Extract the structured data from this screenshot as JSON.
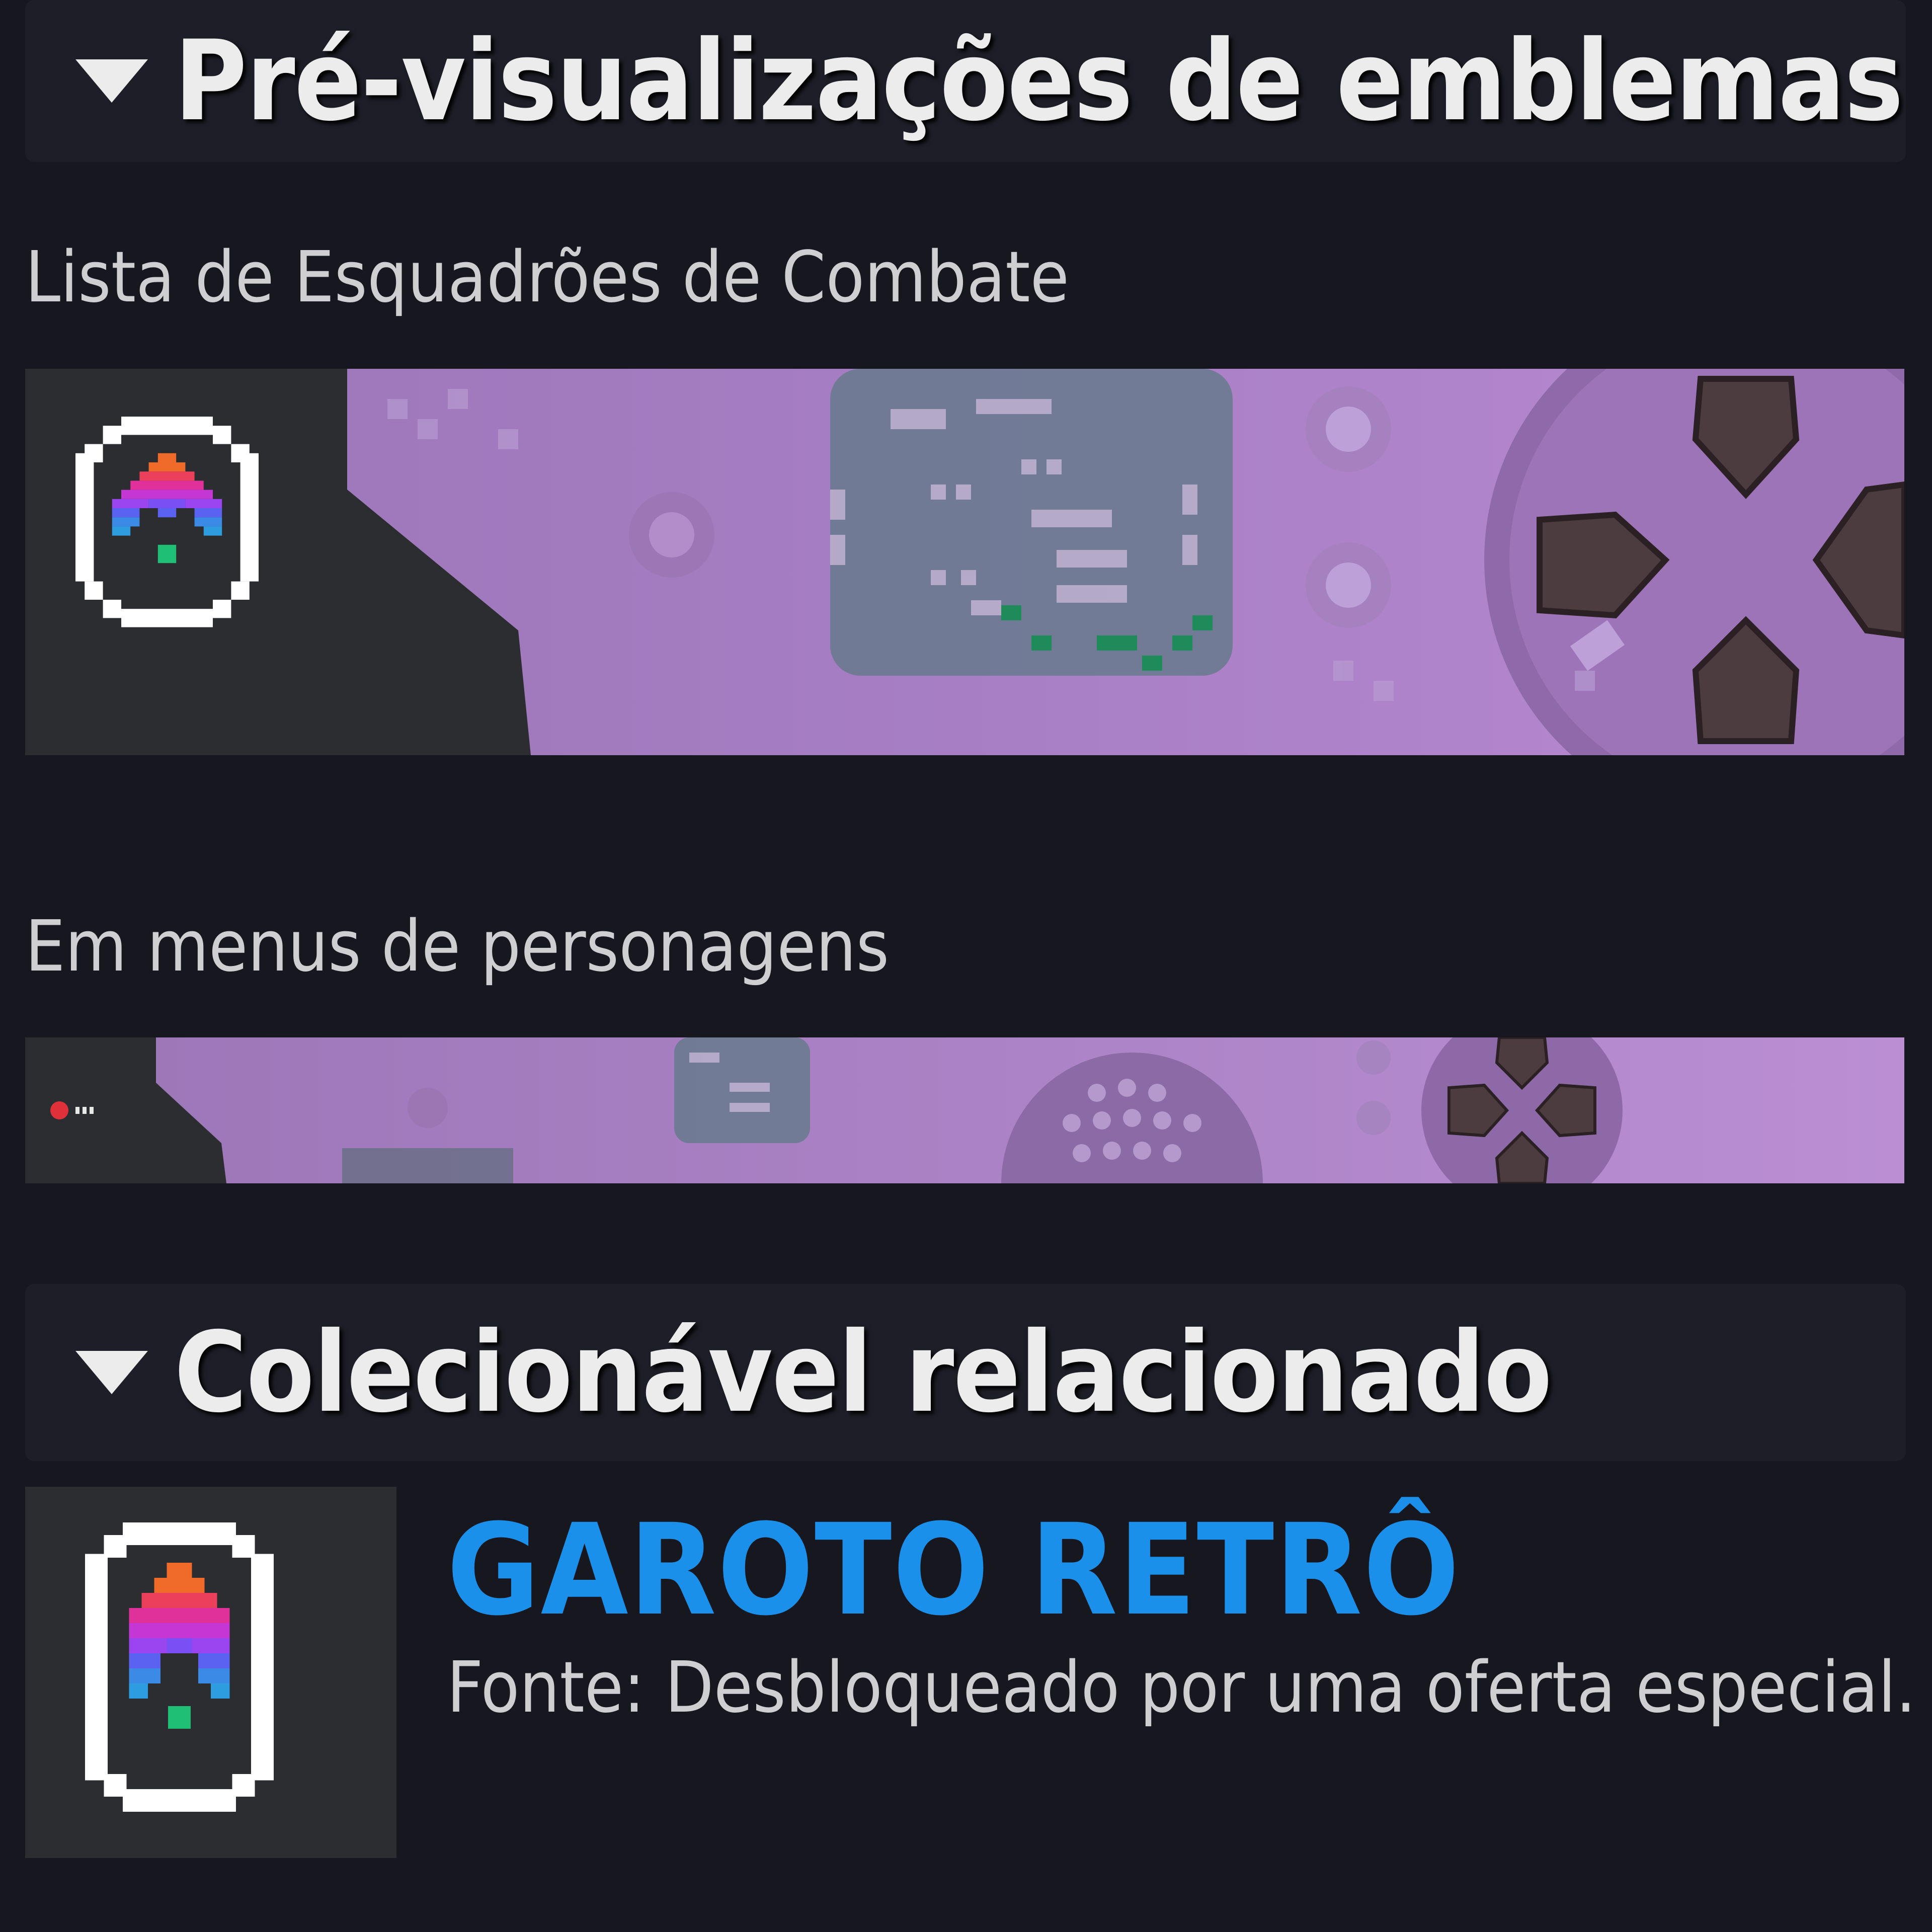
{
  "sections": {
    "previews": {
      "title": "Pré-visualizações de emblemas"
    },
    "related": {
      "title": "Colecionável relacionado"
    }
  },
  "previews": {
    "roster_label": "Lista de Esquadrões de Combate",
    "menus_label": "Em menus de personagens"
  },
  "collectible": {
    "name": "GAROTO RETRÔ",
    "source": "Fonte: Desbloqueado por uma oferta especial."
  },
  "icons": {
    "caret": "caret-down-icon",
    "emblem": "pixel-ship-emblem-icon",
    "dpad": "dpad-icon"
  },
  "colors": {
    "accent": "#1a90ea",
    "banner_purple": "#a87ac6",
    "background": "#16171f"
  }
}
